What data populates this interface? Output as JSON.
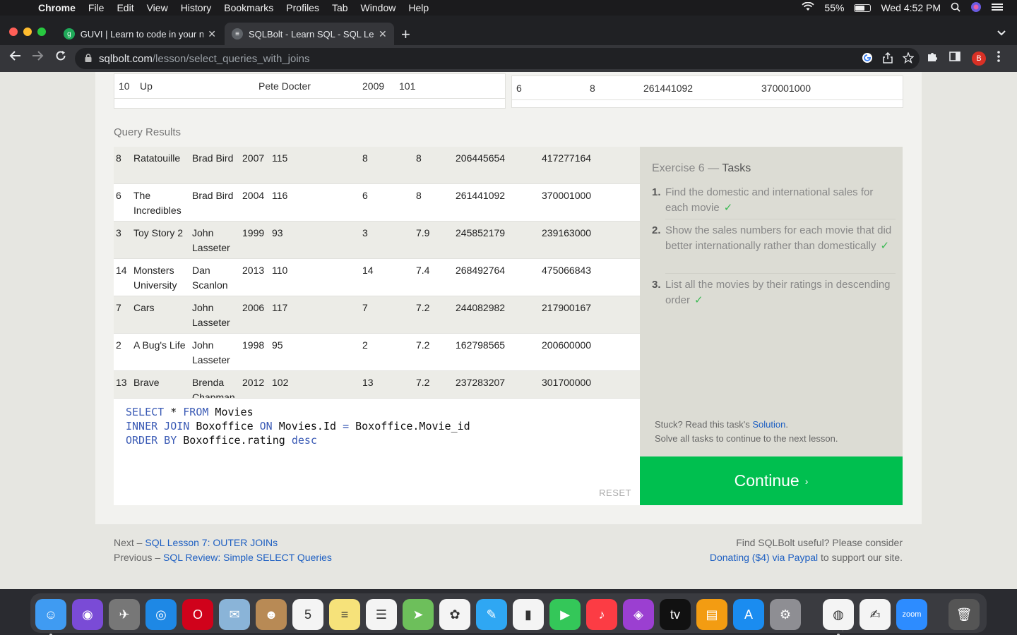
{
  "menubar": {
    "apple": "",
    "items": [
      "Chrome",
      "File",
      "Edit",
      "View",
      "History",
      "Bookmarks",
      "Profiles",
      "Tab",
      "Window",
      "Help"
    ],
    "battery": "55%",
    "clock": "Wed 4:52 PM"
  },
  "tabs": [
    {
      "title": "GUVI | Learn to code in your na",
      "favicon": "g",
      "close": "✕"
    },
    {
      "title": "SQLBolt - Learn SQL - SQL Les",
      "favicon": "≡",
      "close": "✕"
    }
  ],
  "newtab": "+",
  "url": {
    "host": "sqlbolt.com",
    "path": "/lesson/select_queries_with_joins"
  },
  "top_tables": {
    "left_row": [
      "10",
      "Up",
      "Pete Docter",
      "2009",
      "101"
    ],
    "right_row": [
      "6",
      "8",
      "261441092",
      "370001000"
    ]
  },
  "query_results_label": "Query Results",
  "results": [
    {
      "id": "8",
      "title": "Ratatouille",
      "director": "Brad Bird",
      "year": "2007",
      "length": "115",
      "movie_id": "8",
      "rating": "8",
      "domestic": "206445654",
      "international": "417277164"
    },
    {
      "id": "6",
      "title": "The Incredibles",
      "director": "Brad Bird",
      "year": "2004",
      "length": "116",
      "movie_id": "6",
      "rating": "8",
      "domestic": "261441092",
      "international": "370001000"
    },
    {
      "id": "3",
      "title": "Toy Story 2",
      "director": "John Lasseter",
      "year": "1999",
      "length": "93",
      "movie_id": "3",
      "rating": "7.9",
      "domestic": "245852179",
      "international": "239163000"
    },
    {
      "id": "14",
      "title": "Monsters University",
      "director": "Dan Scanlon",
      "year": "2013",
      "length": "110",
      "movie_id": "14",
      "rating": "7.4",
      "domestic": "268492764",
      "international": "475066843"
    },
    {
      "id": "7",
      "title": "Cars",
      "director": "John Lasseter",
      "year": "2006",
      "length": "117",
      "movie_id": "7",
      "rating": "7.2",
      "domestic": "244082982",
      "international": "217900167"
    },
    {
      "id": "2",
      "title": "A Bug's Life",
      "director": "John Lasseter",
      "year": "1998",
      "length": "95",
      "movie_id": "2",
      "rating": "7.2",
      "domestic": "162798565",
      "international": "200600000"
    },
    {
      "id": "13",
      "title": "Brave",
      "director": "Brenda Chapman",
      "year": "2012",
      "length": "102",
      "movie_id": "13",
      "rating": "7.2",
      "domestic": "237283207",
      "international": "301700000"
    }
  ],
  "editor": {
    "lines": [
      [
        {
          "t": "SELECT",
          "k": true
        },
        {
          "t": " * ",
          "k": false
        },
        {
          "t": "FROM",
          "k": true
        },
        {
          "t": " Movies",
          "k": false
        }
      ],
      [
        {
          "t": "INNER JOIN",
          "k": true
        },
        {
          "t": " Boxoffice ",
          "k": false
        },
        {
          "t": "ON",
          "k": true
        },
        {
          "t": " Movies.Id ",
          "k": false
        },
        {
          "t": "=",
          "k": true
        },
        {
          "t": " Boxoffice.Movie_id",
          "k": false
        }
      ],
      [
        {
          "t": "ORDER BY",
          "k": true
        },
        {
          "t": " Boxoffice.rating ",
          "k": false
        },
        {
          "t": "desc",
          "k": true
        }
      ]
    ],
    "reset": "RESET"
  },
  "exercise": {
    "label": "Exercise 6",
    "dash": " — ",
    "tasks_word": "Tasks",
    "tasks": [
      {
        "num": "1.",
        "text": "Find the domestic and international sales for each movie"
      },
      {
        "num": "2.",
        "text": "Show the sales numbers for each movie that did better internationally rather than domestically"
      },
      {
        "num": "3.",
        "text": "List all the movies by their ratings in descending order"
      }
    ],
    "check": "✓",
    "stuck_prefix": "Stuck? Read this task's ",
    "stuck_link": "Solution",
    "stuck_suffix": ".",
    "solve_all": "Solve all tasks to continue to the next lesson.",
    "continue": "Continue",
    "continue_arrow": "›"
  },
  "footer": {
    "next_prefix": "Next – ",
    "next_link": "SQL Lesson 7: OUTER JOINs",
    "prev_prefix": "Previous – ",
    "prev_link": "SQL Review: Simple SELECT Queries",
    "donate_text": "Find SQLBolt useful? Please consider",
    "donate_link": "Donating ($4) via Paypal",
    "donate_suffix": " to support our site."
  },
  "colors": {
    "accent_green": "#00bf4f",
    "link_blue": "#1d5fc2",
    "keyword_blue": "#3b5bb5"
  },
  "dock": [
    {
      "name": "finder-icon",
      "glyph": "☺",
      "bg": "#3f9bf2"
    },
    {
      "name": "siri-icon",
      "glyph": "◉",
      "bg": "#7a4bd6"
    },
    {
      "name": "launchpad-icon",
      "glyph": "✈",
      "bg": "#777"
    },
    {
      "name": "safari-icon",
      "glyph": "◎",
      "bg": "#1e88e5"
    },
    {
      "name": "opera-icon",
      "glyph": "O",
      "bg": "#d0021b"
    },
    {
      "name": "preview-icon",
      "glyph": "✉",
      "bg": "#8ab4d8"
    },
    {
      "name": "contacts-icon",
      "glyph": "☻",
      "bg": "#b88a55"
    },
    {
      "name": "calendar-icon",
      "glyph": "5",
      "bg": "#f4f4f4"
    },
    {
      "name": "notes-icon",
      "glyph": "≡",
      "bg": "#f6e27a"
    },
    {
      "name": "reminders-icon",
      "glyph": "☰",
      "bg": "#f4f4f4"
    },
    {
      "name": "maps-icon",
      "glyph": "➤",
      "bg": "#6dbf5b"
    },
    {
      "name": "photos-icon",
      "glyph": "✿",
      "bg": "#f4f4f4"
    },
    {
      "name": "messages-icon",
      "glyph": "✎",
      "bg": "#2fa7f3"
    },
    {
      "name": "numbers-icon",
      "glyph": "▮",
      "bg": "#f4f4f4"
    },
    {
      "name": "facetime-icon",
      "glyph": "▶",
      "bg": "#34c759"
    },
    {
      "name": "music-icon",
      "glyph": "♪",
      "bg": "#fc3c44"
    },
    {
      "name": "podcasts-icon",
      "glyph": "◈",
      "bg": "#9b3fd1"
    },
    {
      "name": "tv-icon",
      "glyph": "tv",
      "bg": "#111"
    },
    {
      "name": "books-icon",
      "glyph": "▤",
      "bg": "#f39c12"
    },
    {
      "name": "app-store-icon",
      "glyph": "A",
      "bg": "#1a8cf0"
    },
    {
      "name": "system-preferences-icon",
      "glyph": "⚙",
      "bg": "#8e8e93"
    },
    {
      "name": "chrome-icon",
      "glyph": "◍",
      "bg": "#f4f4f4"
    },
    {
      "name": "textedit-icon",
      "glyph": "✍",
      "bg": "#f4f4f4"
    },
    {
      "name": "zoom-icon",
      "glyph": "zoom",
      "bg": "#2d8cff"
    },
    {
      "name": "trash-icon",
      "glyph": "🗑",
      "bg": "#555"
    }
  ]
}
